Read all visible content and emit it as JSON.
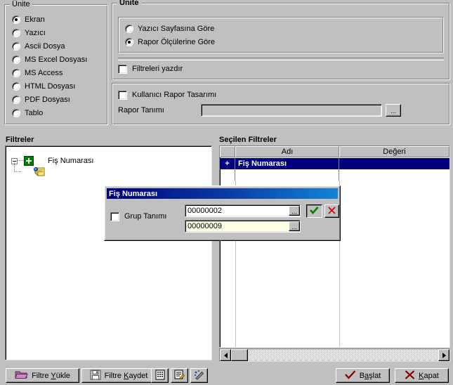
{
  "unit_group": {
    "title": "Ünite",
    "options": [
      {
        "label": "Ekran",
        "selected": true
      },
      {
        "label": "Yazıcı",
        "selected": false
      },
      {
        "label": "Ascii Dosya",
        "selected": false
      },
      {
        "label": "MS Excel Dosyası",
        "selected": false
      },
      {
        "label": "MS Access",
        "selected": false
      },
      {
        "label": "HTML Dosyası",
        "selected": false
      },
      {
        "label": "PDF Dosyası",
        "selected": false
      },
      {
        "label": "Tablo",
        "selected": false
      }
    ]
  },
  "unit_panel": {
    "title": "Ünite",
    "options": [
      {
        "label": "Yazıcı Sayfasına Göre",
        "selected": false
      },
      {
        "label": "Rapor Ölçülerine Göre",
        "selected": true
      }
    ],
    "print_filters": {
      "label": "Filtreleri yazdır",
      "checked": false
    }
  },
  "report_design": {
    "user_design": {
      "label": "Kullanıcı Rapor Tasarımı",
      "checked": false
    },
    "definition_label": "Rapor Tanımı",
    "definition_value": "",
    "browse_label": "..."
  },
  "filters": {
    "heading": "Filtreler",
    "tree": [
      {
        "label": "Fiş Numarası",
        "icon": "green-plus-icon"
      },
      {
        "label": "",
        "icon": "note-pin-icon"
      }
    ]
  },
  "selected_filters": {
    "heading": "Seçilen Filtreler",
    "columns": [
      "",
      "Adı",
      "Değeri"
    ],
    "rows": [
      {
        "indicator": "+",
        "name": "Fiş Numarası",
        "value": "",
        "selected": true
      }
    ]
  },
  "dialog": {
    "title": "Fiş Numarası",
    "group_def": {
      "label": "Grup Tanımı",
      "checked": false
    },
    "value_start": "00000002",
    "value_end": "00000009",
    "browse_label": "...",
    "ok_icon": "check-icon",
    "cancel_icon": "x-icon"
  },
  "toolbar": {
    "load_filter": {
      "label_pre": "Filtre ",
      "accel": "Y",
      "label_post": "ükle",
      "icon": "folder-icon"
    },
    "save_filter": {
      "label_pre": "Filtre ",
      "accel": "K",
      "label_post": "aydet",
      "icon": "floppy-icon"
    },
    "icon_buttons": [
      "report-preview-icon",
      "form-edit-icon",
      "wand-icon"
    ],
    "start": {
      "label_pre": "B",
      "accel": "a",
      "label_post": "şlat",
      "icon": "check-icon"
    },
    "close": {
      "label_pre": "",
      "accel": "K",
      "label_post": "apat",
      "icon": "x-icon"
    }
  },
  "colors": {
    "face": "#c0c0c0",
    "selection": "#000080",
    "accent_green": "#008000",
    "accent_red": "#c00000",
    "title_blue": "#00007b"
  }
}
